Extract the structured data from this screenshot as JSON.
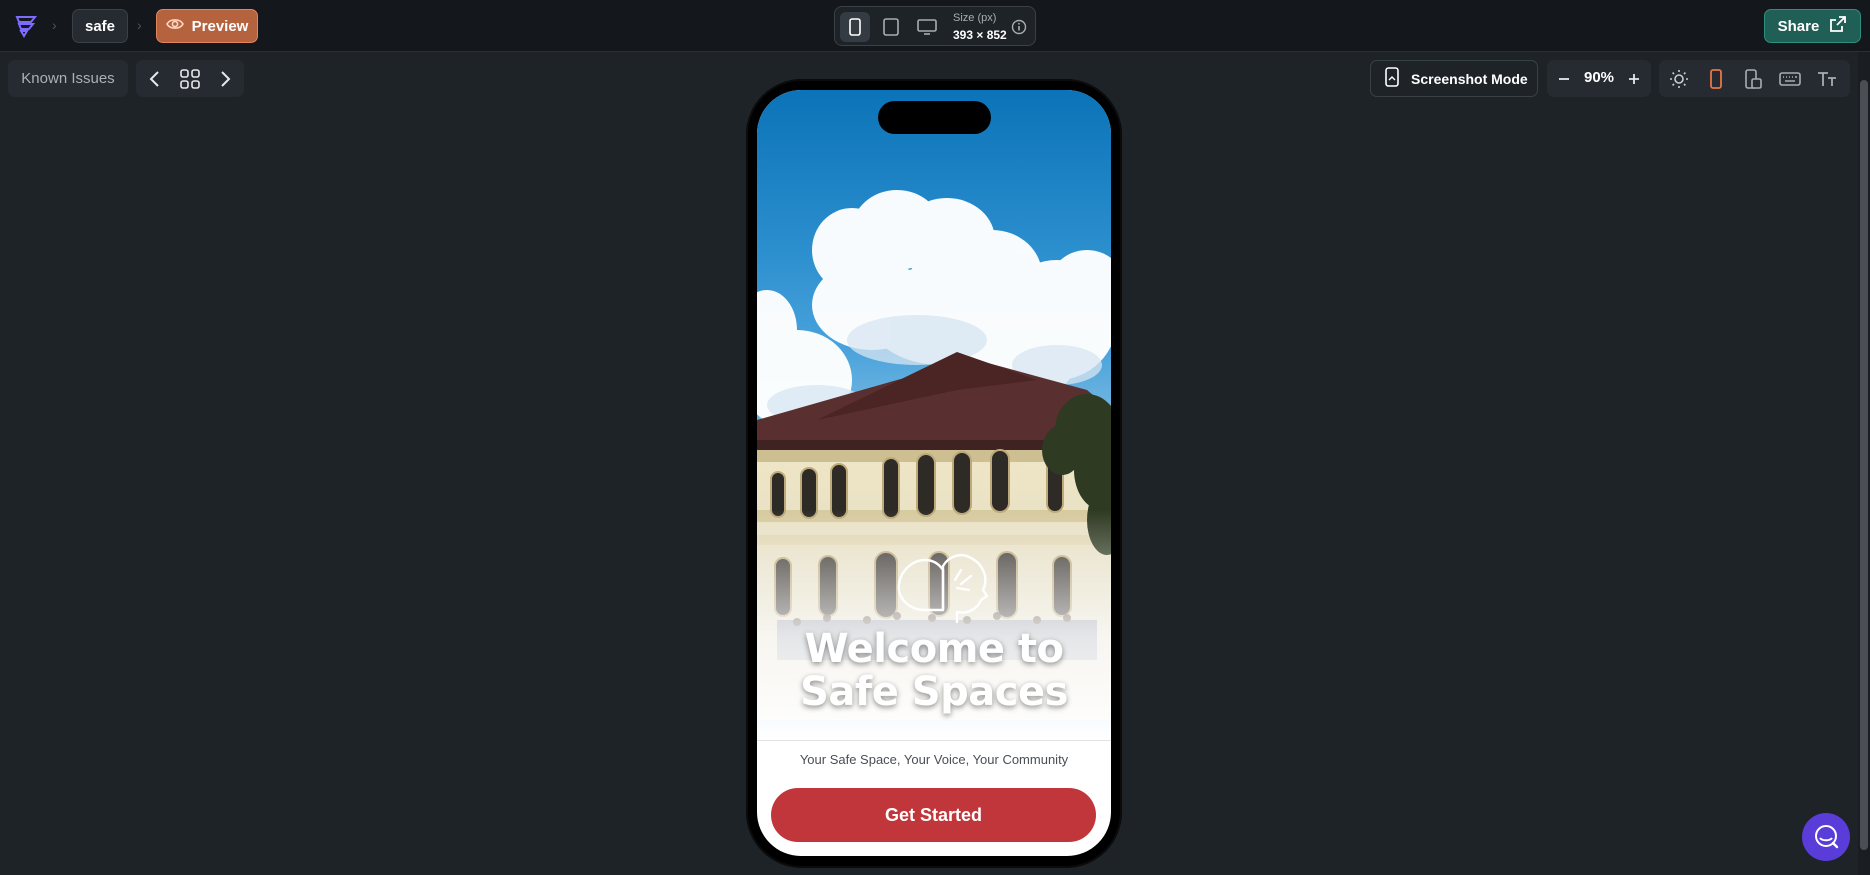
{
  "topbar": {
    "project_name": "safe",
    "preview_label": "Preview",
    "size_label": "Size (px)",
    "size_value": "393 × 852",
    "share_label": "Share"
  },
  "toolbar": {
    "known_issues_label": "Known Issues",
    "screenshot_mode_label": "Screenshot Mode",
    "zoom_value": "90%"
  },
  "phone_app": {
    "title_line1": "Welcome to",
    "title_line2": "Safe Spaces",
    "tagline": "Your Safe Space, Your Voice, Your Community",
    "cta_label": "Get Started"
  },
  "colors": {
    "accent_orange": "#e2855d",
    "share_green": "#1f5f55",
    "cta_red": "#c1363a",
    "chat_purple": "#5a3dd8"
  },
  "icons": {
    "logo": "logo-icon",
    "preview": "eye-icon",
    "devices": [
      "phone-icon",
      "tablet-icon",
      "desktop-icon"
    ],
    "nav": [
      "chevron-left-icon",
      "grid-icon",
      "chevron-right-icon"
    ],
    "tools": [
      "sun-icon",
      "phone-portrait-icon",
      "phone-landscape-icon",
      "keyboard-icon",
      "text-size-icon"
    ],
    "chat": "search-chat-icon"
  }
}
